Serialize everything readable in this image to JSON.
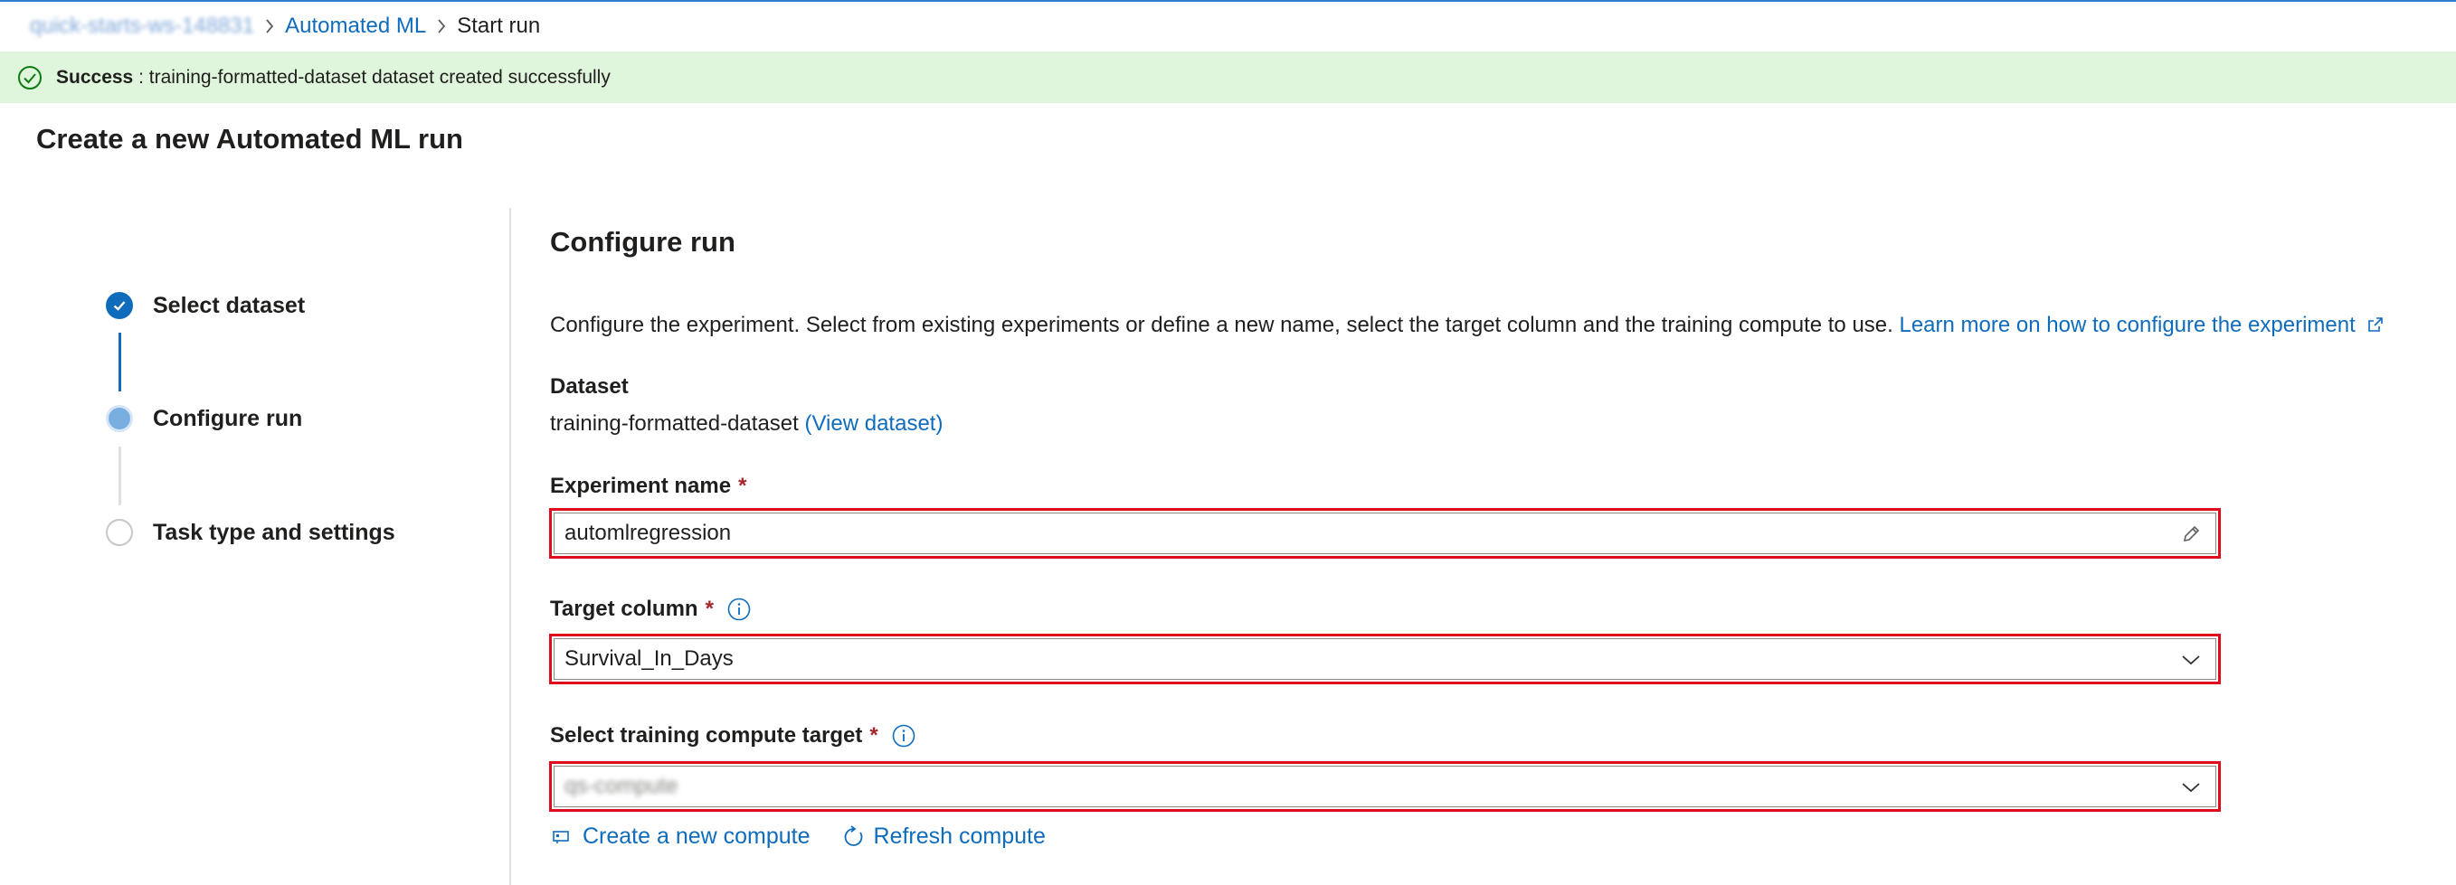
{
  "breadcrumb": {
    "workspace": "quick-starts-ws-148831",
    "section": "Automated ML",
    "current": "Start run"
  },
  "banner": {
    "title": "Success",
    "message": " : training-formatted-dataset dataset created successfully"
  },
  "page_title": "Create a new Automated ML run",
  "steps": [
    {
      "label": "Select dataset",
      "state": "done"
    },
    {
      "label": "Configure run",
      "state": "current"
    },
    {
      "label": "Task type and settings",
      "state": "todo"
    }
  ],
  "main": {
    "title": "Configure run",
    "description": "Configure the experiment. Select from existing experiments or define a new name, select the target column and the training compute to use.",
    "learn_more": "Learn more on how to configure the experiment",
    "dataset_label": "Dataset",
    "dataset_name": "training-formatted-dataset",
    "view_dataset": "(View dataset)",
    "experiment_label": "Experiment name",
    "experiment_value": "automlregression",
    "target_label": "Target column",
    "target_value": "Survival_In_Days",
    "compute_label": "Select training compute target",
    "compute_value": "qs-compute",
    "required_mark": "*",
    "create_compute": "Create a new compute",
    "refresh_compute": "Refresh compute"
  },
  "colors": {
    "accent": "#0f6cbd",
    "success_bg": "#dff6dd",
    "success_icon": "#107c10",
    "highlight_border": "#e00b1c",
    "required": "#a4262c"
  },
  "icons": [
    "chevron-right-icon",
    "check-circle-icon",
    "edit-icon",
    "chevron-down-icon",
    "info-icon",
    "external-link-icon",
    "compute-icon",
    "refresh-icon"
  ]
}
